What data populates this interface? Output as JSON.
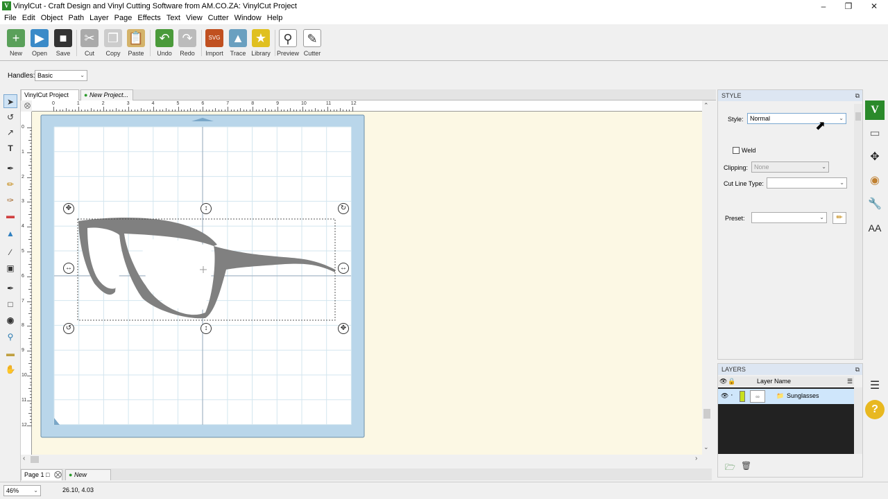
{
  "window": {
    "title": "VinylCut - Craft Design and Vinyl Cutting Software from AM.CO.ZA: VinylCut Project",
    "app_icon": "V"
  },
  "menu": [
    "File",
    "Edit",
    "Object",
    "Path",
    "Layer",
    "Page",
    "Effects",
    "Text",
    "View",
    "Cutter",
    "Window",
    "Help"
  ],
  "toolbar": [
    {
      "label": "New",
      "icon": "new-doc-icon",
      "color": "#5aa05a"
    },
    {
      "label": "Open",
      "icon": "open-icon",
      "color": "#3a8ac8"
    },
    {
      "label": "Save",
      "icon": "save-icon",
      "color": "#333333"
    },
    {
      "label": "Cut",
      "icon": "cut-icon",
      "color": "#999999"
    },
    {
      "label": "Copy",
      "icon": "copy-icon",
      "color": "#cccccc"
    },
    {
      "label": "Paste",
      "icon": "paste-icon",
      "color": "#d4b36a"
    },
    {
      "label": "Undo",
      "icon": "undo-icon",
      "color": "#4a9a3a"
    },
    {
      "label": "Redo",
      "icon": "redo-icon",
      "color": "#bbbbbb"
    },
    {
      "label": "Import",
      "icon": "import-icon",
      "color": "#c05020"
    },
    {
      "label": "Trace",
      "icon": "trace-icon",
      "color": "#6aa0c0"
    },
    {
      "label": "Library",
      "icon": "library-icon",
      "color": "#e0c020"
    },
    {
      "label": "Preview",
      "icon": "preview-icon",
      "color": "#444444"
    },
    {
      "label": "Cutter",
      "icon": "cutter-icon",
      "color": "#555555"
    }
  ],
  "handles": {
    "label": "Handles:",
    "value": "Basic"
  },
  "doc_tabs": {
    "active": "VinylCut Project",
    "new": "New Project..."
  },
  "ruler": {
    "h_numbers": [
      "0",
      "1",
      "2",
      "3",
      "4",
      "5",
      "6",
      "7",
      "8",
      "9",
      "10",
      "11",
      "12"
    ],
    "v_numbers": [
      "0",
      "1",
      "2",
      "3",
      "4",
      "5",
      "6",
      "7",
      "8",
      "9",
      "10",
      "11",
      "12"
    ]
  },
  "pages": {
    "current": "Page 1",
    "new": "New Page..."
  },
  "status": {
    "zoom": "46%",
    "coords": "26.10, 4.03"
  },
  "style_panel": {
    "title": "STYLE",
    "style_label": "Style:",
    "style_value": "Normal",
    "weld_label": "Weld",
    "weld_checked": false,
    "clipping_label": "Clipping:",
    "clipping_value": "None",
    "cutline_label": "Cut Line Type:",
    "cutline_value": "",
    "preset_label": "Preset:",
    "preset_value": ""
  },
  "layers_panel": {
    "title": "LAYERS",
    "column": "Layer Name",
    "layers": [
      {
        "name": "Sunglasses",
        "color": "#c8e020"
      }
    ]
  },
  "colors": {
    "mat": "#b9d6ea",
    "canvas": "#fcf8e4",
    "shape": "#808080",
    "accent": "#dde6f2",
    "layer_highlight": "#cfe6fb"
  }
}
